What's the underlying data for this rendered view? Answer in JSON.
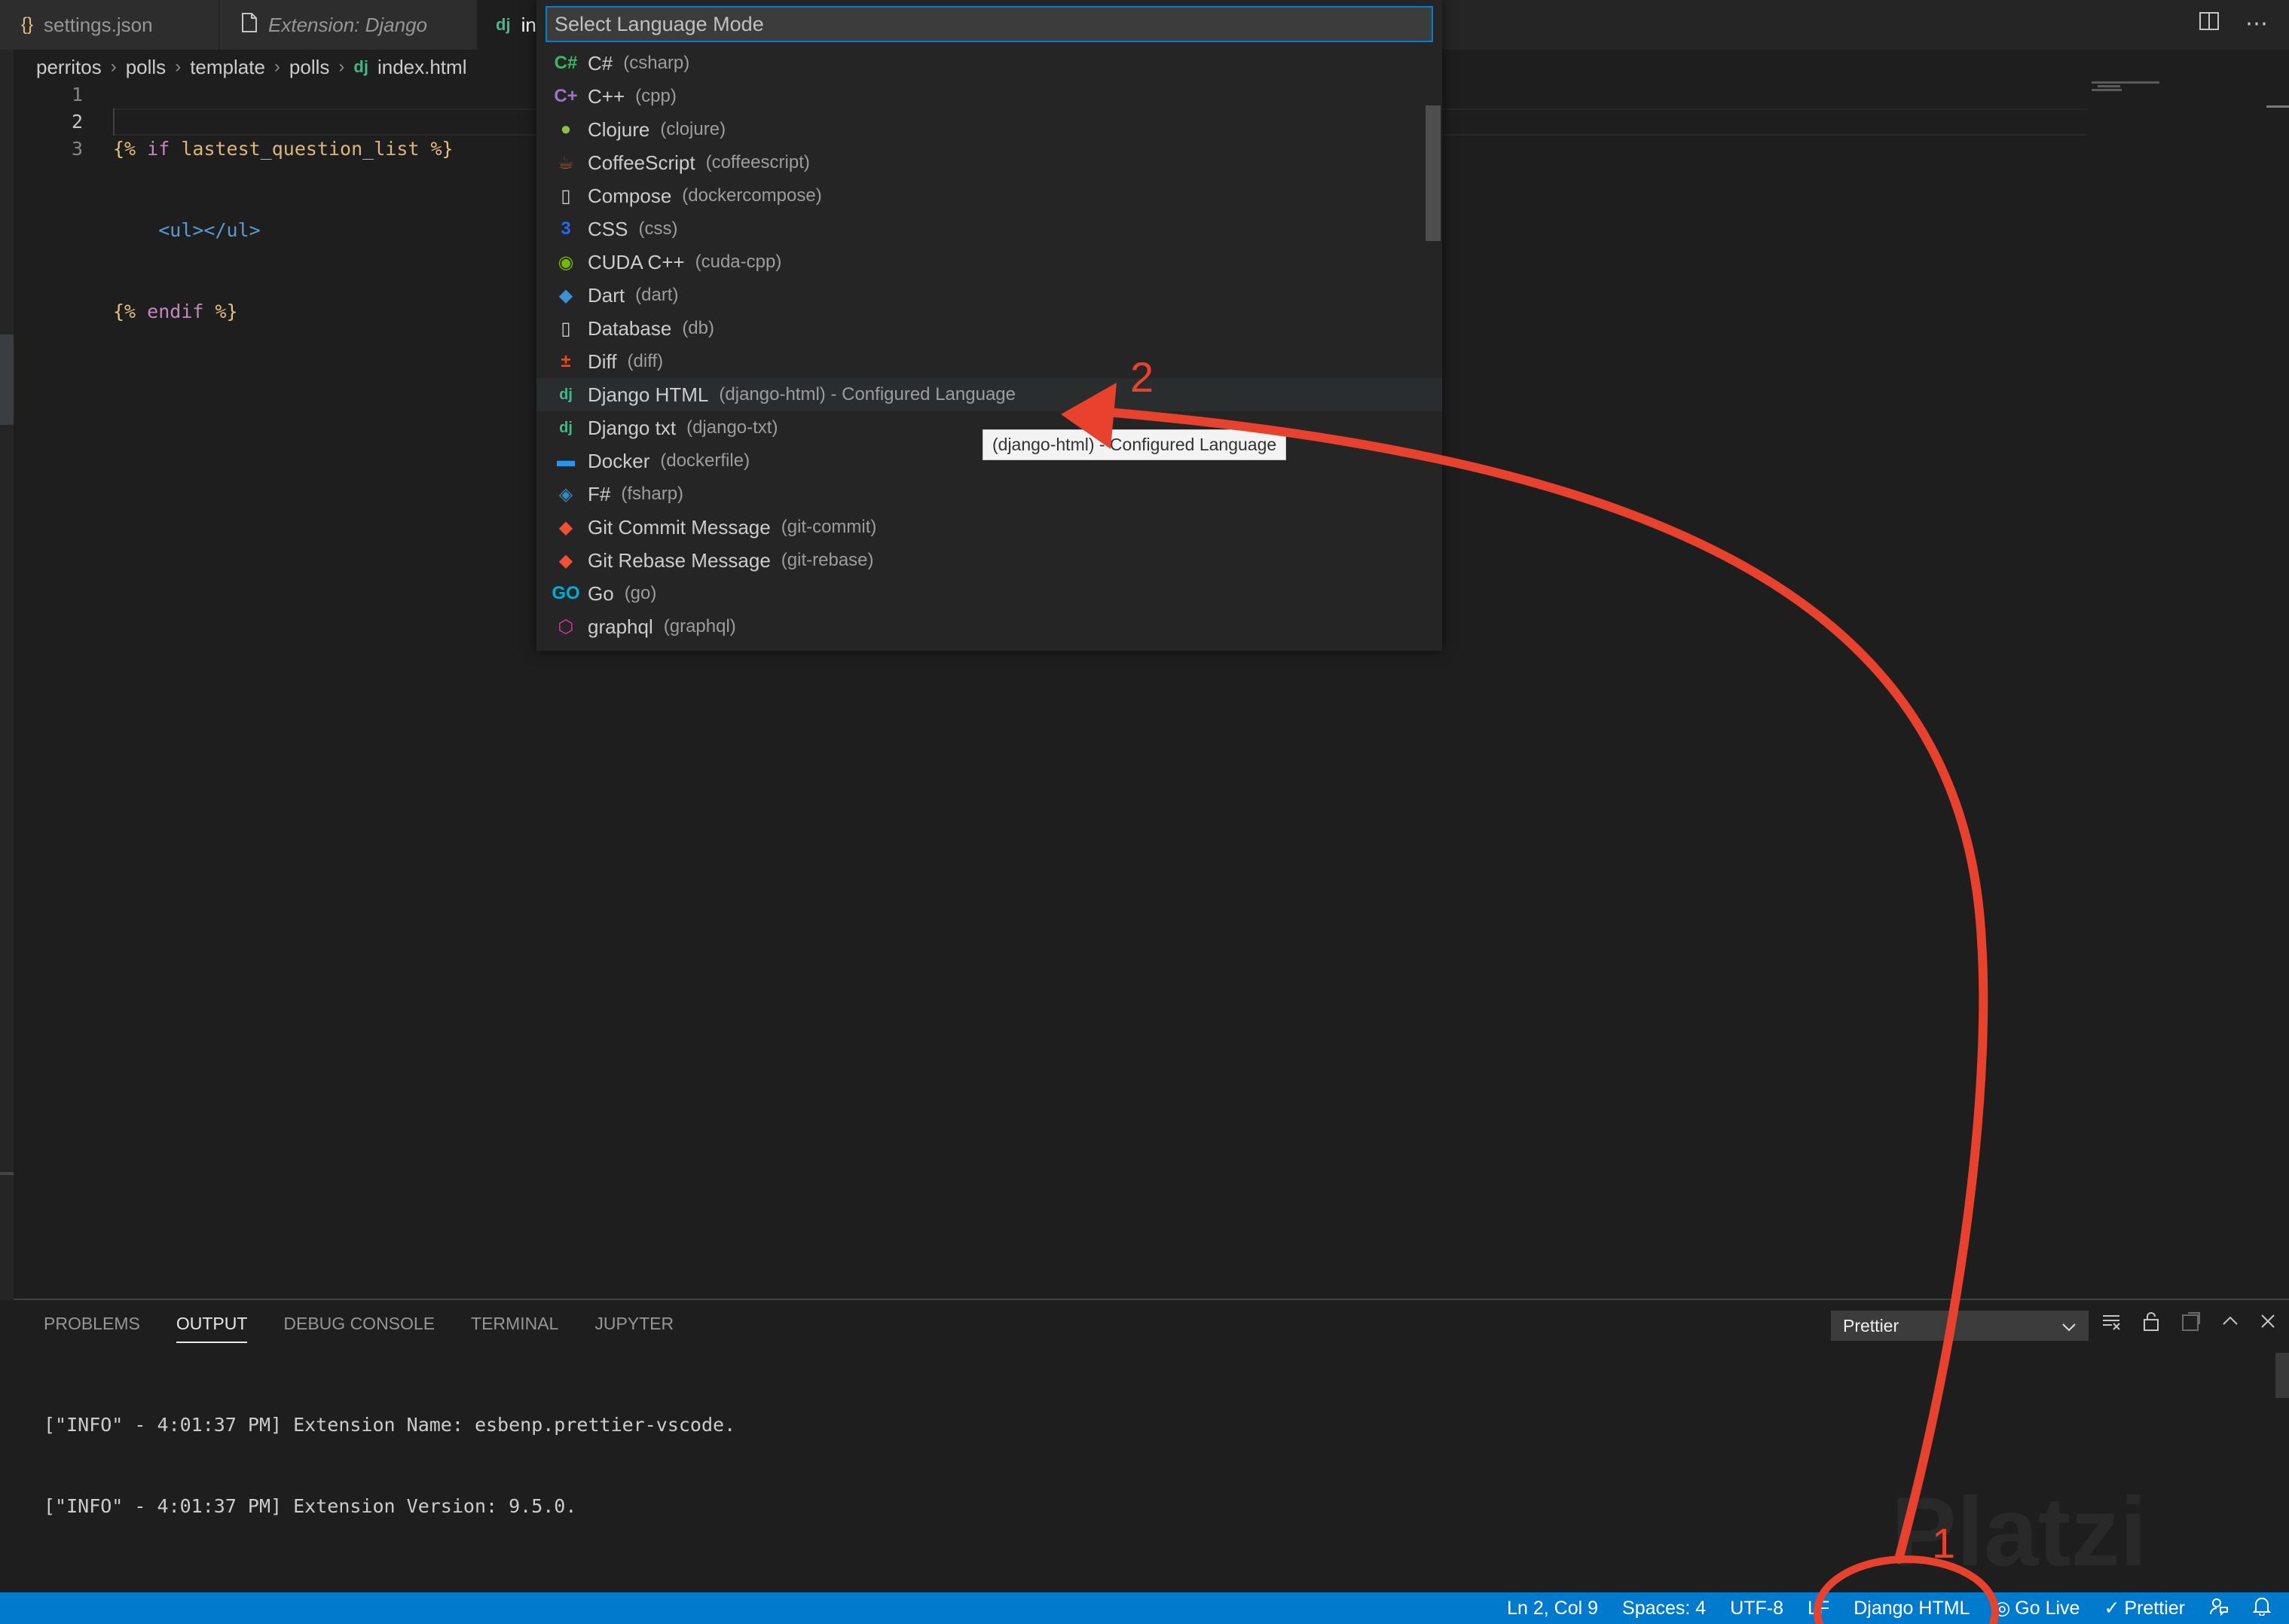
{
  "tabs": [
    {
      "label": "settings.json",
      "icon": "{}"
    },
    {
      "label": "Extension: Django",
      "icon": "file-icon"
    },
    {
      "label": "in",
      "icon": "dj"
    }
  ],
  "breadcrumb": [
    "perritos",
    "polls",
    "template",
    "polls",
    "index.html"
  ],
  "breadcrumb_file_icon": "dj",
  "editor": {
    "line_numbers": [
      "1",
      "2",
      "3"
    ],
    "lines": [
      {
        "open": "{%",
        "kw": "if",
        "var": "lastest_question_list",
        "close": "%}"
      },
      {
        "html": "<ul></ul>"
      },
      {
        "open": "{%",
        "kw": "endif",
        "close": "%}"
      }
    ]
  },
  "quick_pick": {
    "placeholder": "Select Language Mode",
    "items": [
      {
        "label": "C#",
        "desc": "(csharp)",
        "icon": "C#",
        "color": "#3bba61"
      },
      {
        "label": "C++",
        "desc": "(cpp)",
        "icon": "C+",
        "color": "#a074c4"
      },
      {
        "label": "Clojure",
        "desc": "(clojure)",
        "icon": "●",
        "color": "#8bc34a"
      },
      {
        "label": "CoffeeScript",
        "desc": "(coffeescript)",
        "icon": "☕",
        "color": "#a0522d"
      },
      {
        "label": "Compose",
        "desc": "(dockercompose)",
        "icon": "▯",
        "color": "#cccccc"
      },
      {
        "label": "CSS",
        "desc": "(css)",
        "icon": "3",
        "color": "#2965f1"
      },
      {
        "label": "CUDA C++",
        "desc": "(cuda-cpp)",
        "icon": "◉",
        "color": "#76b900"
      },
      {
        "label": "Dart",
        "desc": "(dart)",
        "icon": "◆",
        "color": "#3d8fd6"
      },
      {
        "label": "Database",
        "desc": "(db)",
        "icon": "▯",
        "color": "#cccccc"
      },
      {
        "label": "Diff",
        "desc": "(diff)",
        "icon": "±",
        "color": "#e34c26"
      },
      {
        "label": "Django HTML",
        "desc": "(django-html) - Configured Language",
        "icon": "dj",
        "color": "#44b78b"
      },
      {
        "label": "Django txt",
        "desc": "(django-txt)",
        "icon": "dj",
        "color": "#44b78b"
      },
      {
        "label": "Docker",
        "desc": "(dockerfile)",
        "icon": "▬",
        "color": "#2496ed"
      },
      {
        "label": "F#",
        "desc": "(fsharp)",
        "icon": "◈",
        "color": "#378bba"
      },
      {
        "label": "Git Commit Message",
        "desc": "(git-commit)",
        "icon": "◆",
        "color": "#f05033"
      },
      {
        "label": "Git Rebase Message",
        "desc": "(git-rebase)",
        "icon": "◆",
        "color": "#f05033"
      },
      {
        "label": "Go",
        "desc": "(go)",
        "icon": "GO",
        "color": "#00add8"
      },
      {
        "label": "graphql",
        "desc": "(graphql)",
        "icon": "⬡",
        "color": "#e535ab"
      }
    ],
    "tooltip": "(django-html) - Configured Language"
  },
  "panel": {
    "tabs": [
      "PROBLEMS",
      "OUTPUT",
      "DEBUG CONSOLE",
      "TERMINAL",
      "JUPYTER"
    ],
    "active_tab": "OUTPUT",
    "channel": "Prettier",
    "output_lines": [
      "[\"INFO\" - 4:01:37 PM] Extension Name: esbenp.prettier-vscode.",
      "[\"INFO\" - 4:01:37 PM] Extension Version: 9.5.0."
    ]
  },
  "statusbar": {
    "position": "Ln 2, Col 9",
    "spaces": "Spaces: 4",
    "encoding": "UTF-8",
    "eol": "LF",
    "language": "Django HTML",
    "go_live": "Go Live",
    "prettier": "Prettier"
  },
  "annotations": {
    "label1": "1",
    "label2": "2",
    "color": "#e8412d"
  },
  "watermark": "Platzi",
  "colors": {
    "accent": "#007acc",
    "focus_border": "#007fd4",
    "annotation": "#e8412d"
  }
}
